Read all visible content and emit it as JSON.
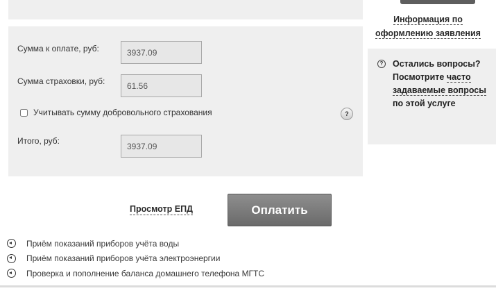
{
  "info": {
    "link_line1": "Информация по",
    "link_line2": "оформлению заявления"
  },
  "payment": {
    "amount_label": "Сумма к оплате, руб:",
    "amount_value": "3937.09",
    "insurance_label": "Сумма страховки, руб:",
    "insurance_value": "61.56",
    "checkbox_label": "Учитывать сумму добровольного страхования",
    "checkbox_checked": false,
    "help_icon": "?",
    "total_label": "Итого, руб:",
    "total_value": "3937.09"
  },
  "sidebar": {
    "icon": "?",
    "part1": "Остались вопросы? Посмотрите",
    "link": "часто задаваемые вопросы",
    "part2": "по этой услуге"
  },
  "actions": {
    "epd_label": "Просмотр ЕПД",
    "pay_label": "Оплатить"
  },
  "links": [
    "Приём показаний приборов учёта воды",
    "Приём показаний приборов учёта электроэнергии",
    "Проверка и пополнение баланса домашнего телефона МГТС"
  ],
  "icons": {
    "link_icon": "arrow-left-circle-icon"
  },
  "colors": {
    "panel_bg": "#efefef",
    "button_bg": "#7a7a7a",
    "text": "#2b2b2b"
  }
}
